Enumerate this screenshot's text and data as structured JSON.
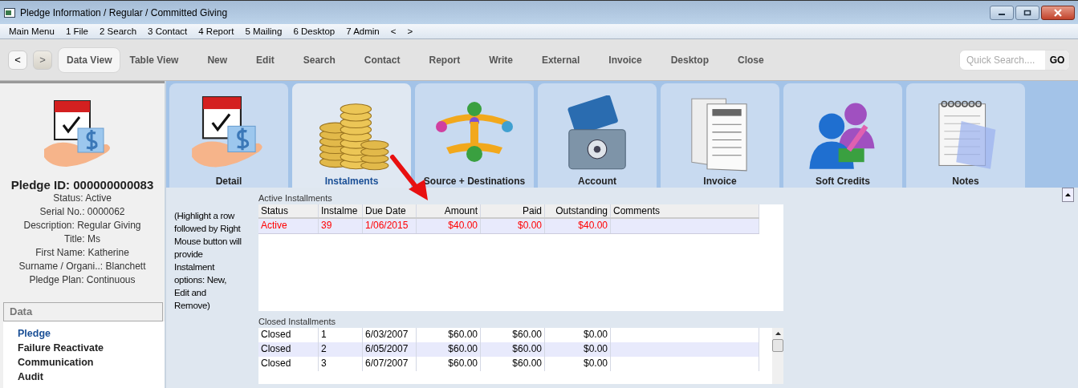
{
  "window": {
    "title": "Pledge Information / Regular / Committed Giving"
  },
  "menu_bar": [
    "Main Menu",
    "1 File",
    "2 Search",
    "3 Contact",
    "4 Report",
    "5 Mailing",
    "6 Desktop",
    "7 Admin",
    "<",
    ">"
  ],
  "toolbar": {
    "back": {
      "label": "<",
      "disabled": false
    },
    "forward": {
      "label": ">",
      "disabled": true
    },
    "buttons": [
      {
        "label": "Data View",
        "selected": true
      },
      {
        "label": "Table View",
        "selected": false
      },
      {
        "label": "New",
        "selected": false
      },
      {
        "label": "Edit",
        "selected": false
      },
      {
        "label": "Search",
        "selected": false
      },
      {
        "label": "Contact",
        "selected": false
      },
      {
        "label": "Report",
        "selected": false
      },
      {
        "label": "Write",
        "selected": false
      },
      {
        "label": "External",
        "selected": false
      },
      {
        "label": "Invoice",
        "selected": false
      },
      {
        "label": "Desktop",
        "selected": false
      },
      {
        "label": "Close",
        "selected": false
      }
    ],
    "quick_search": {
      "placeholder": "Quick Search....",
      "button": "GO"
    }
  },
  "sidebar": {
    "title": "Pledge ID: 000000000083",
    "details": [
      "Status: Active",
      "Serial No.: 0000062",
      "Description: Regular Giving",
      "Title: Ms",
      "First Name: Katherine",
      "Surname / Organi..: Blanchett",
      "Pledge Plan: Continuous"
    ],
    "section": "Data",
    "items": [
      {
        "label": "Pledge",
        "selected": true
      },
      {
        "label": "Failure Reactivate",
        "selected": false
      },
      {
        "label": "Communication",
        "selected": false
      },
      {
        "label": "Audit",
        "selected": false
      }
    ]
  },
  "tabs": [
    {
      "label": "Detail",
      "kind": "pledge",
      "selected": false
    },
    {
      "label": "Instalments",
      "kind": "coins",
      "selected": true
    },
    {
      "label": "Source + Destinations",
      "kind": "scales",
      "selected": false
    },
    {
      "label": "Account",
      "kind": "safe",
      "selected": false
    },
    {
      "label": "Invoice",
      "kind": "invoice",
      "selected": false
    },
    {
      "label": "Soft Credits",
      "kind": "people",
      "selected": false
    },
    {
      "label": "Notes",
      "kind": "notepad",
      "selected": false
    }
  ],
  "hint": "(Highlight a row followed by Right Mouse button will provide Instalment options: New, Edit and Remove)",
  "active_installments": {
    "title": "Active Installments",
    "columns": [
      "Status",
      "Instalme",
      "Due Date",
      "Amount",
      "Paid",
      "Outstanding",
      "Comments"
    ],
    "rows": [
      {
        "color": "#ff0000",
        "cells": [
          "Active",
          "39",
          "1/06/2015",
          "$40.00",
          "$0.00",
          "$40.00",
          ""
        ]
      }
    ]
  },
  "closed_installments": {
    "title": "Closed Installments",
    "rows": [
      {
        "color": "#000000",
        "cells": [
          "Closed",
          "1",
          "6/03/2007",
          "$60.00",
          "$60.00",
          "$0.00",
          ""
        ]
      },
      {
        "color": "#000000",
        "cells": [
          "Closed",
          "2",
          "6/05/2007",
          "$60.00",
          "$60.00",
          "$0.00",
          ""
        ]
      },
      {
        "color": "#000000",
        "cells": [
          "Closed",
          "3",
          "6/07/2007",
          "$60.00",
          "$60.00",
          "$0.00",
          ""
        ]
      }
    ]
  }
}
